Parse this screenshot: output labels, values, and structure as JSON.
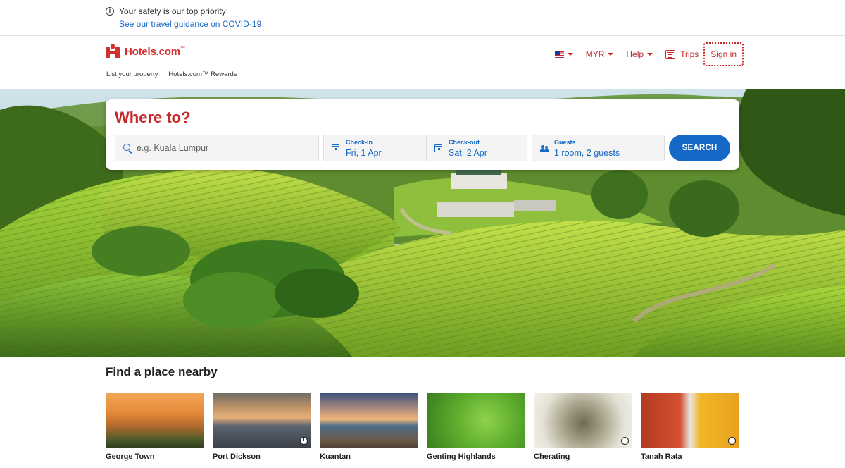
{
  "safety_banner": {
    "icon": "info-icon",
    "title": "Your safety is our top priority",
    "link": "See our travel guidance on COVID-19"
  },
  "header": {
    "logo_text": "Hotels.com",
    "logo_tm": "™",
    "subnav": [
      "List your property",
      "Hotels.com™ Rewards"
    ],
    "nav": {
      "flag_icon": "malaysia-flag-icon",
      "currency": "MYR",
      "help": "Help",
      "trips": "Trips",
      "sign_in": "Sign in"
    },
    "brand_color": "#d32f2f"
  },
  "search": {
    "heading": "Where to?",
    "destination_placeholder": "e.g. Kuala Lumpur",
    "destination_value": "",
    "checkin_label": "Check-in",
    "checkin_value": "Fri, 1 Apr",
    "checkout_label": "Check-out",
    "checkout_value": "Sat, 2 Apr",
    "guests_label": "Guests",
    "guests_value": "1 room, 2 guests",
    "button": "SEARCH",
    "accent_color": "#1668c7"
  },
  "nearby": {
    "title": "Find a place nearby",
    "places": [
      {
        "name": "George Town",
        "info": false
      },
      {
        "name": "Port Dickson",
        "info": true
      },
      {
        "name": "Kuantan",
        "info": false
      },
      {
        "name": "Genting Highlands",
        "info": false
      },
      {
        "name": "Cherating",
        "info": true
      },
      {
        "name": "Tanah Rata",
        "info": true
      }
    ]
  }
}
